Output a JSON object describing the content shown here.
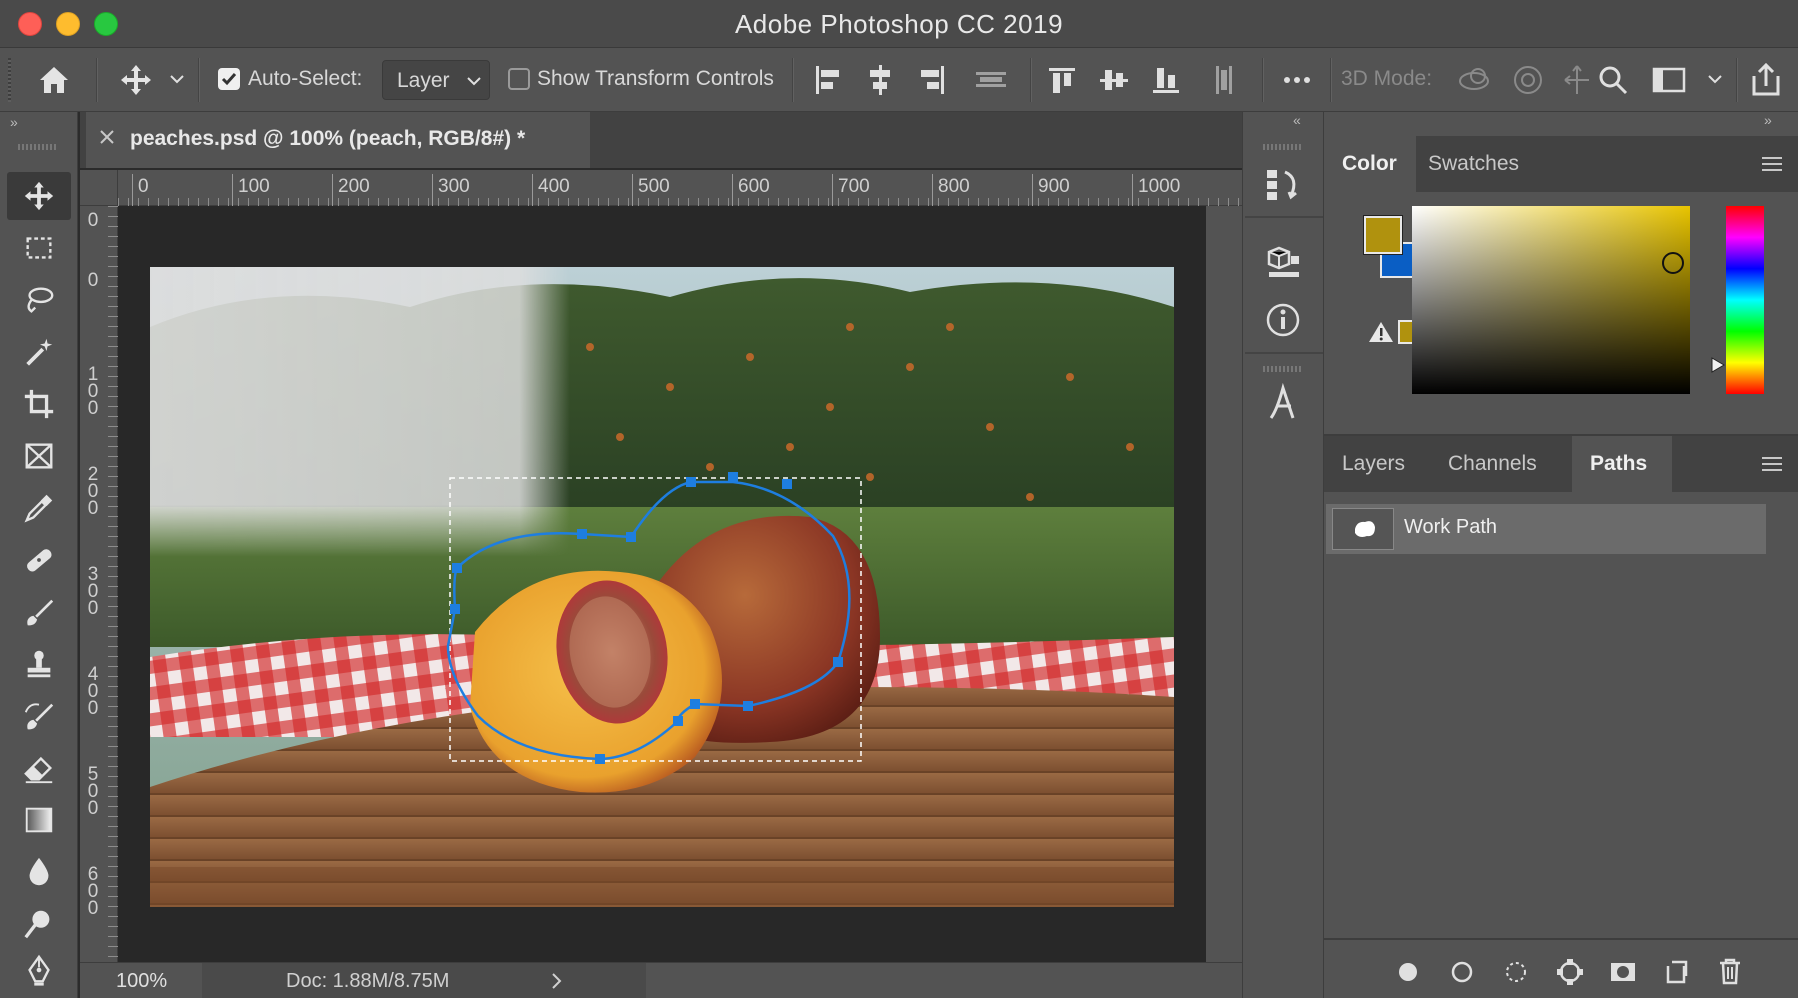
{
  "window": {
    "title": "Adobe Photoshop CC 2019"
  },
  "options_bar": {
    "auto_select_label": "Auto-Select:",
    "auto_select_value": "Layer",
    "show_transform_label": "Show Transform Controls",
    "mode_3d_label": "3D Mode:"
  },
  "document": {
    "tab_title": "peaches.psd @ 100% (peach, RGB/8#) *",
    "zoom": "100%",
    "doc_info": "Doc: 1.88M/8.75M",
    "ruler_h": [
      "0",
      "100",
      "200",
      "300",
      "400",
      "500",
      "600",
      "700",
      "800",
      "900",
      "1000"
    ],
    "ruler_v": [
      "0",
      "0",
      "100",
      "200",
      "300",
      "400",
      "500",
      "600"
    ]
  },
  "color_panel": {
    "tabs": [
      "Color",
      "Swatches"
    ],
    "active_tab": "Color",
    "foreground": "#b0920e",
    "background": "#0a5ec4"
  },
  "layers_panel": {
    "tabs": [
      "Layers",
      "Channels",
      "Paths"
    ],
    "active_tab": "Paths",
    "paths": [
      {
        "name": "Work Path"
      }
    ]
  },
  "colors": {
    "accent": "#1e7ee0",
    "panel_bg": "#535353",
    "canvas_bg": "#282828"
  }
}
